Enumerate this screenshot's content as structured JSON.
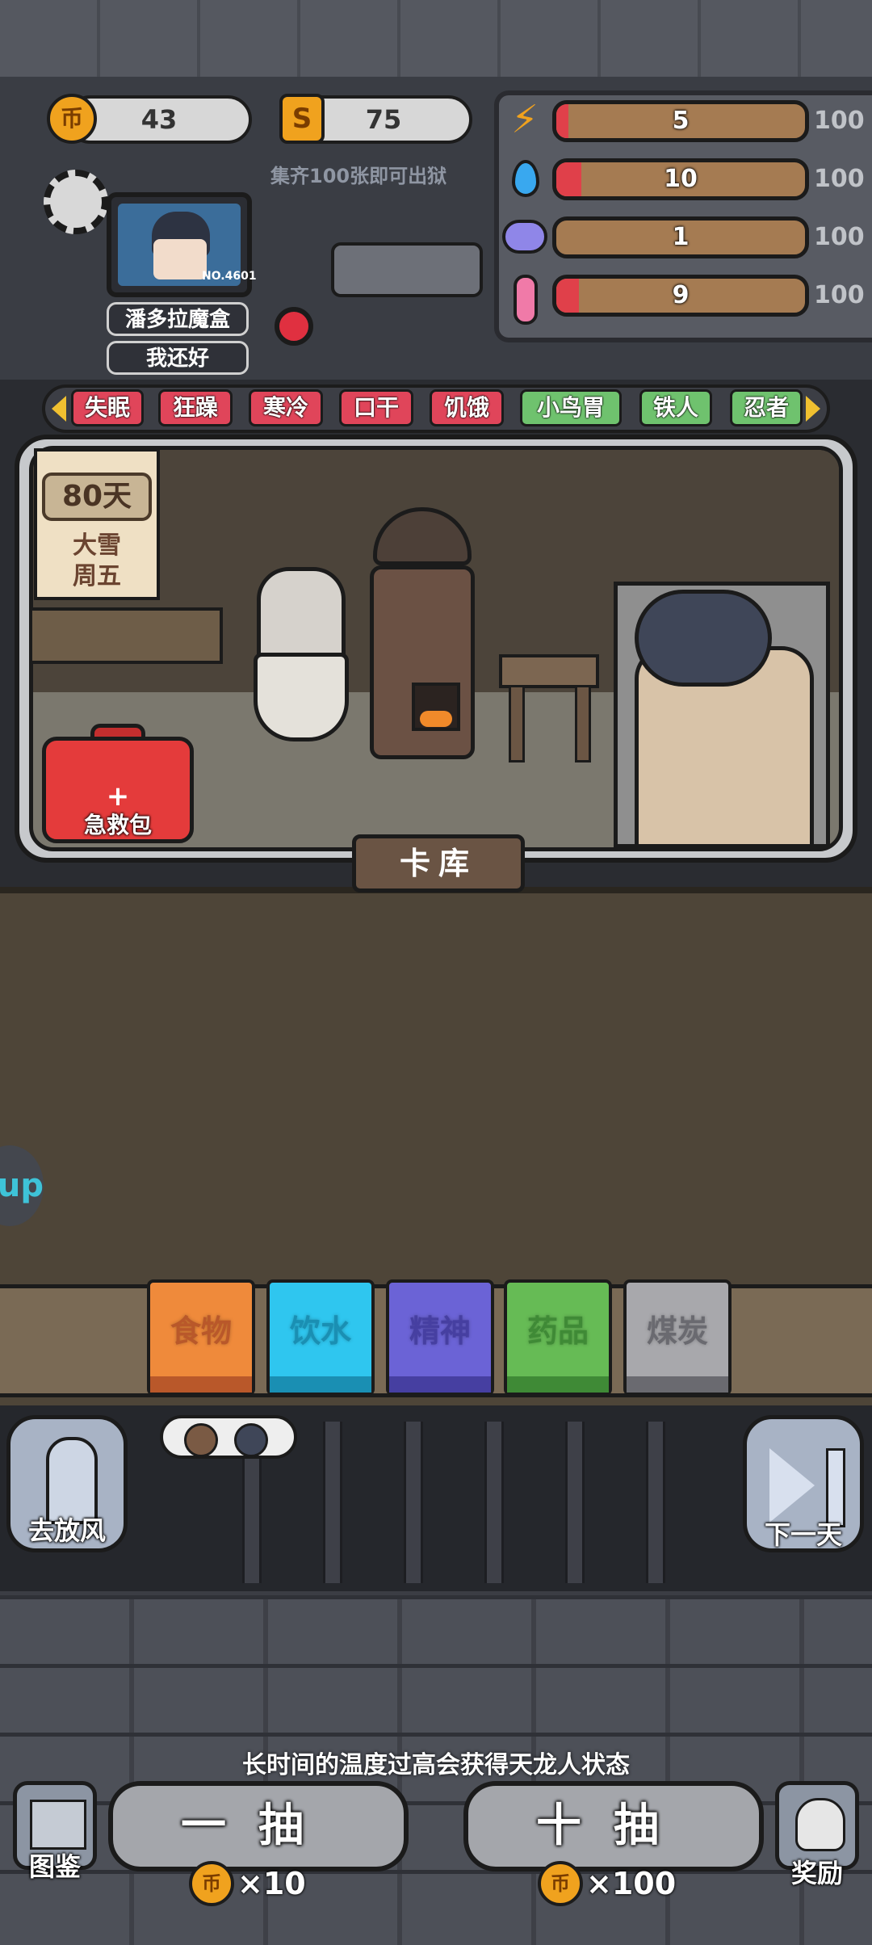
{
  "currency": {
    "coins": "43",
    "coin_symbol": "币",
    "tickets": "75",
    "ticket_symbol": "S",
    "hint": "集齐100张即可出狱"
  },
  "stats": [
    {
      "icon": "lightning-icon",
      "value": "5",
      "max": "100",
      "fill": 0.05
    },
    {
      "icon": "water-drop-icon",
      "value": "10",
      "max": "100",
      "fill": 0.1
    },
    {
      "icon": "brain-icon",
      "value": "1",
      "max": "100",
      "fill": 0.01
    },
    {
      "icon": "thermometer-icon",
      "value": "9",
      "max": "100",
      "fill": 0.09
    }
  ],
  "character": {
    "id_label": "NO.4601",
    "item_tag": "潘多拉魔盒",
    "mood_tag": "我还好"
  },
  "effects": [
    {
      "label": "失眠",
      "color": "red"
    },
    {
      "label": "狂躁",
      "color": "red"
    },
    {
      "label": "寒冷",
      "color": "red"
    },
    {
      "label": "口干",
      "color": "red"
    },
    {
      "label": "饥饿",
      "color": "red"
    },
    {
      "label": "小鸟胃",
      "color": "green"
    },
    {
      "label": "铁人",
      "color": "green"
    },
    {
      "label": "忍者",
      "color": "green"
    }
  ],
  "calendar": {
    "day": "80天",
    "weather": "大雪",
    "weekday": "周五"
  },
  "room": {
    "first_aid_label": "急救包",
    "first_aid_symbol": "+",
    "library_title": "卡库"
  },
  "side_tab": "up",
  "cards": [
    {
      "label": "食物",
      "color": "#ef8a3b",
      "base": "#b9582a"
    },
    {
      "label": "饮水",
      "color": "#2fc6ef",
      "base": "#1a8fb3"
    },
    {
      "label": "精神",
      "color": "#6b63d6",
      "base": "#463fa1"
    },
    {
      "label": "药品",
      "color": "#66bb55",
      "base": "#3f8a36"
    },
    {
      "label": "煤炭",
      "color": "#a8a8ac",
      "base": "#6a6a70"
    }
  ],
  "controls": {
    "left_button": "去放风",
    "right_button": "下一天",
    "tip": "长时间的温度过高会获得天龙人状态",
    "draw_one": "一抽",
    "draw_one_cost": "×10",
    "draw_ten": "十抽",
    "draw_ten_cost": "×100",
    "codex": "图鉴",
    "reward": "奖励"
  },
  "colors": {
    "accent_red": "#e0455a",
    "accent_green": "#6fc26e",
    "coin_gold": "#f0a21e"
  }
}
